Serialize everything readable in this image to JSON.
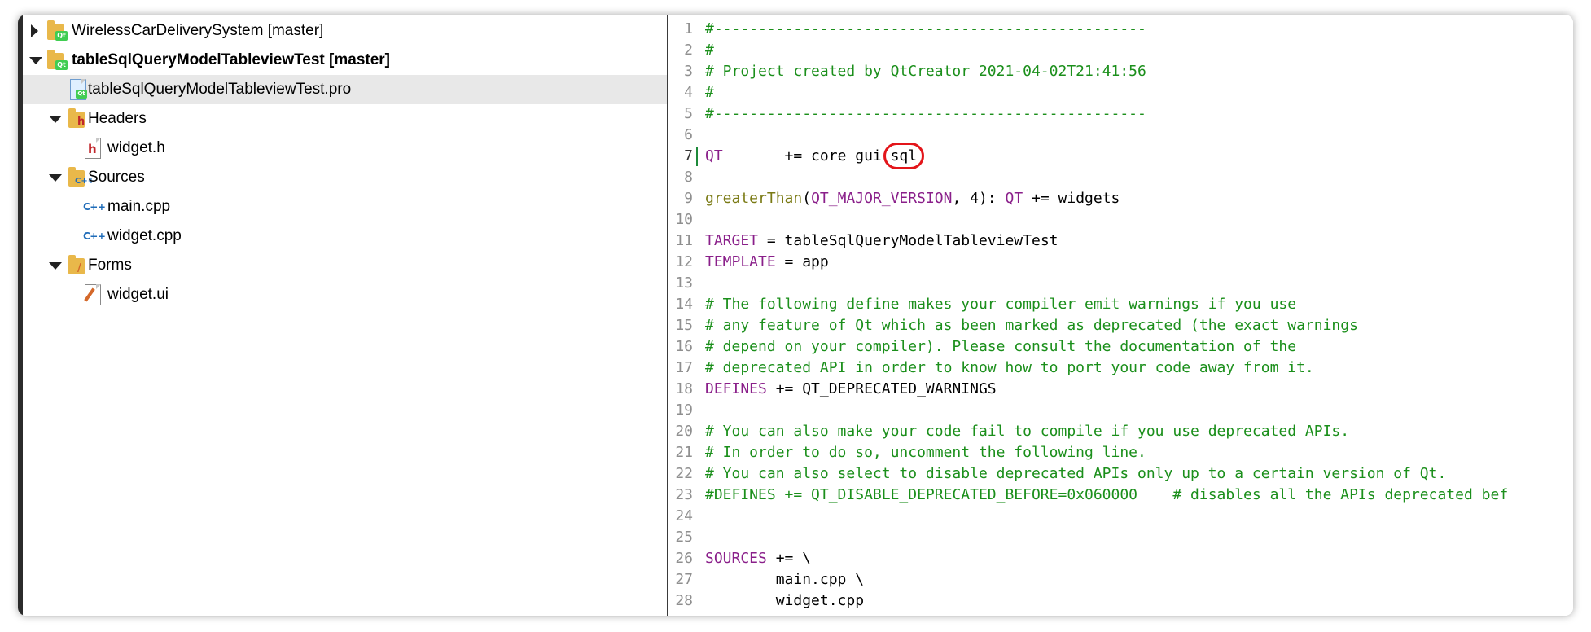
{
  "project_tree": {
    "items": [
      {
        "label": "WirelessCarDeliverySystem [master]",
        "icon": "qt-project-folder-icon",
        "expanded": false,
        "bold": false,
        "selected": false,
        "level": 0
      },
      {
        "label": "tableSqlQueryModelTableviewTest [master]",
        "icon": "qt-project-folder-icon",
        "expanded": true,
        "bold": true,
        "selected": false,
        "level": 0
      },
      {
        "label": "tableSqlQueryModelTableviewTest.pro",
        "icon": "pro-file-icon",
        "bold": false,
        "selected": true,
        "level": 1
      },
      {
        "label": "Headers",
        "icon": "headers-folder-icon",
        "expanded": true,
        "bold": false,
        "selected": false,
        "level": 1
      },
      {
        "label": "widget.h",
        "icon": "header-file-icon",
        "bold": false,
        "selected": false,
        "level": 2
      },
      {
        "label": "Sources",
        "icon": "sources-folder-icon",
        "expanded": true,
        "bold": false,
        "selected": false,
        "level": 1
      },
      {
        "label": "main.cpp",
        "icon": "cpp-file-icon",
        "bold": false,
        "selected": false,
        "level": 2
      },
      {
        "label": "widget.cpp",
        "icon": "cpp-file-icon",
        "bold": false,
        "selected": false,
        "level": 2
      },
      {
        "label": "Forms",
        "icon": "forms-folder-icon",
        "expanded": true,
        "bold": false,
        "selected": false,
        "level": 1
      },
      {
        "label": "widget.ui",
        "icon": "ui-file-icon",
        "bold": false,
        "selected": false,
        "level": 2
      }
    ]
  },
  "editor": {
    "current_line": 7,
    "highlight_annotation": "sql",
    "lines": [
      {
        "n": "1",
        "tokens": [
          [
            "cm",
            "#-------------------------------------------------"
          ]
        ]
      },
      {
        "n": "2",
        "tokens": [
          [
            "cm",
            "#"
          ]
        ]
      },
      {
        "n": "3",
        "tokens": [
          [
            "cm",
            "# Project created by QtCreator 2021-04-02T21:41:56"
          ]
        ]
      },
      {
        "n": "4",
        "tokens": [
          [
            "cm",
            "#"
          ]
        ]
      },
      {
        "n": "5",
        "tokens": [
          [
            "cm",
            "#-------------------------------------------------"
          ]
        ]
      },
      {
        "n": "6",
        "tokens": []
      },
      {
        "n": "7",
        "tokens": [
          [
            "kw",
            "QT"
          ],
          [
            "tx",
            "       += core gui "
          ],
          [
            "tx",
            "sql"
          ]
        ]
      },
      {
        "n": "8",
        "tokens": []
      },
      {
        "n": "9",
        "tokens": [
          [
            "fn",
            "greaterThan"
          ],
          [
            "tx",
            "("
          ],
          [
            "kw",
            "QT_MAJOR_VERSION"
          ],
          [
            "tx",
            ", 4): "
          ],
          [
            "kw",
            "QT"
          ],
          [
            "tx",
            " += widgets"
          ]
        ]
      },
      {
        "n": "10",
        "tokens": []
      },
      {
        "n": "11",
        "tokens": [
          [
            "kw",
            "TARGET"
          ],
          [
            "tx",
            " = tableSqlQueryModelTableviewTest"
          ]
        ]
      },
      {
        "n": "12",
        "tokens": [
          [
            "kw",
            "TEMPLATE"
          ],
          [
            "tx",
            " = app"
          ]
        ]
      },
      {
        "n": "13",
        "tokens": []
      },
      {
        "n": "14",
        "tokens": [
          [
            "cm",
            "# The following define makes your compiler emit warnings if you use"
          ]
        ]
      },
      {
        "n": "15",
        "tokens": [
          [
            "cm",
            "# any feature of Qt which as been marked as deprecated (the exact warnings"
          ]
        ]
      },
      {
        "n": "16",
        "tokens": [
          [
            "cm",
            "# depend on your compiler). Please consult the documentation of the"
          ]
        ]
      },
      {
        "n": "17",
        "tokens": [
          [
            "cm",
            "# deprecated API in order to know how to port your code away from it."
          ]
        ]
      },
      {
        "n": "18",
        "tokens": [
          [
            "kw",
            "DEFINES"
          ],
          [
            "tx",
            " += QT_DEPRECATED_WARNINGS"
          ]
        ]
      },
      {
        "n": "19",
        "tokens": []
      },
      {
        "n": "20",
        "tokens": [
          [
            "cm",
            "# You can also make your code fail to compile if you use deprecated APIs."
          ]
        ]
      },
      {
        "n": "21",
        "tokens": [
          [
            "cm",
            "# In order to do so, uncomment the following line."
          ]
        ]
      },
      {
        "n": "22",
        "tokens": [
          [
            "cm",
            "# You can also select to disable deprecated APIs only up to a certain version of Qt."
          ]
        ]
      },
      {
        "n": "23",
        "tokens": [
          [
            "cm",
            "#DEFINES += QT_DISABLE_DEPRECATED_BEFORE=0x060000    # disables all the APIs deprecated bef"
          ]
        ]
      },
      {
        "n": "24",
        "tokens": []
      },
      {
        "n": "25",
        "tokens": []
      },
      {
        "n": "26",
        "tokens": [
          [
            "kw",
            "SOURCES"
          ],
          [
            "tx",
            " += \\"
          ]
        ]
      },
      {
        "n": "27",
        "tokens": [
          [
            "tx",
            "        main.cpp \\"
          ]
        ]
      },
      {
        "n": "28",
        "tokens": [
          [
            "tx",
            "        widget.cpp"
          ]
        ]
      }
    ]
  },
  "colors": {
    "comment": "#1b8f1b",
    "keyword": "#8a1f8a",
    "function": "#7a7a14",
    "annotation": "#e3151a",
    "selection": "#e8e8e8"
  }
}
